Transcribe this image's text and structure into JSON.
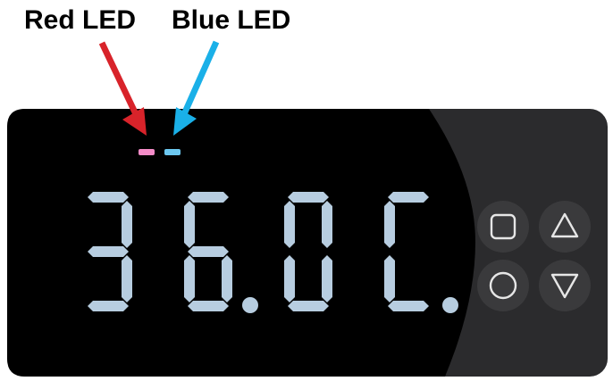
{
  "callouts": {
    "red_led_label": "Red LED",
    "blue_led_label": "Blue LED"
  },
  "display": {
    "readout": "36.0C."
  },
  "buttons": [
    {
      "name": "square-button",
      "icon": "square-icon"
    },
    {
      "name": "up-button",
      "icon": "triangle-up-icon"
    },
    {
      "name": "circle-button",
      "icon": "circle-icon"
    },
    {
      "name": "down-button",
      "icon": "triangle-down-icon"
    }
  ],
  "colors": {
    "red_arrow": "#d8232a",
    "blue_arrow": "#1ab0e8",
    "red_led": "#f58cc8",
    "blue_led": "#6cc8f0",
    "segment": "#b7cde0",
    "device_body": "#000000",
    "button_panel": "#2b2b2d",
    "button_glyph": "#e6e6e6"
  }
}
